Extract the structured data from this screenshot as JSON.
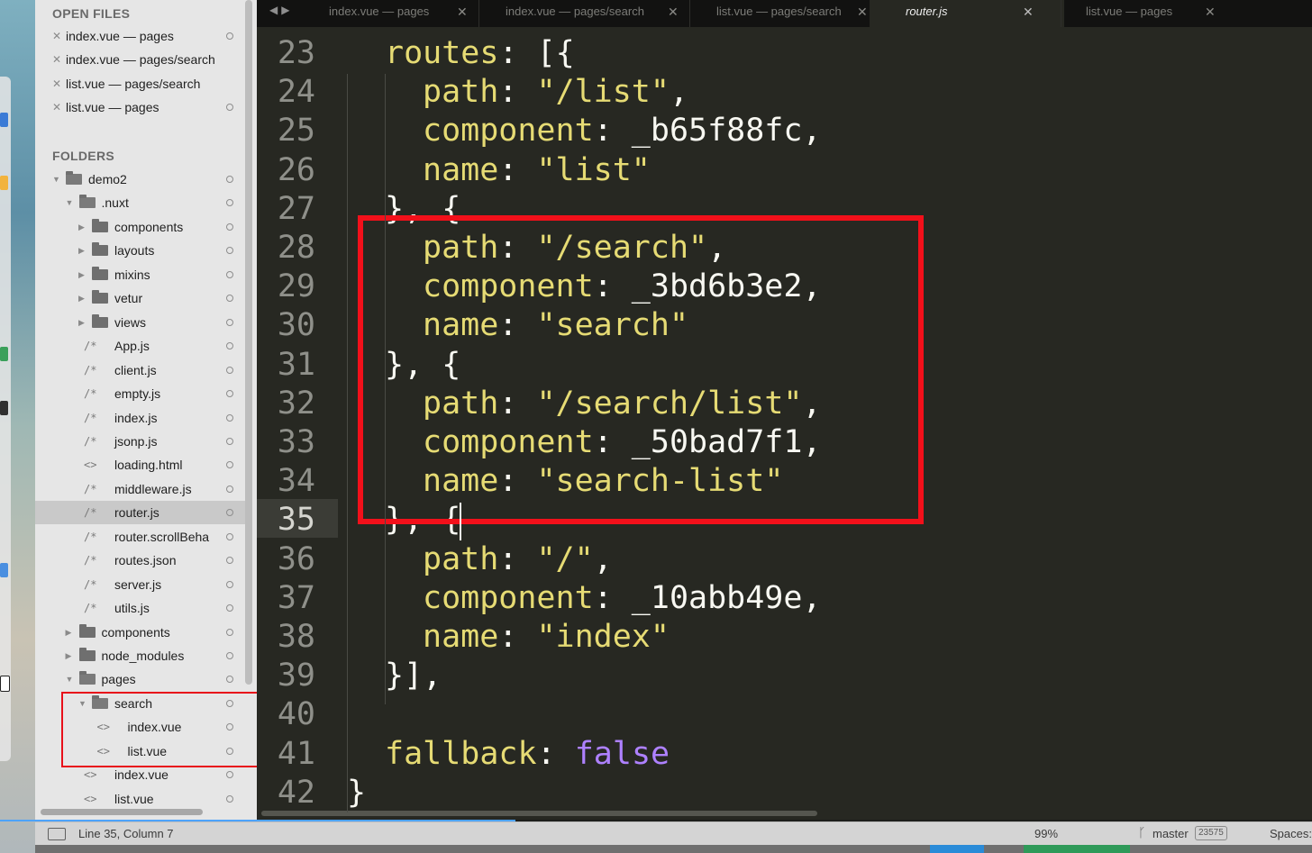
{
  "tabs": [
    {
      "label": "index.vue — pages",
      "active": false
    },
    {
      "label": "index.vue — pages/search",
      "active": false
    },
    {
      "label": "list.vue — pages/search",
      "active": false
    },
    {
      "label": "router.js",
      "active": true
    },
    {
      "label": "list.vue — pages",
      "active": false
    }
  ],
  "sidebar": {
    "open_files_header": "OPEN FILES",
    "open_files": [
      "index.vue — pages",
      "index.vue — pages/search",
      "list.vue — pages/search",
      "list.vue — pages"
    ],
    "folders_header": "FOLDERS",
    "tree": [
      {
        "label": "demo2",
        "type": "folder-open",
        "depth": 0
      },
      {
        "label": ".nuxt",
        "type": "folder-open",
        "depth": 1
      },
      {
        "label": "components",
        "type": "folder",
        "depth": 2
      },
      {
        "label": "layouts",
        "type": "folder",
        "depth": 2
      },
      {
        "label": "mixins",
        "type": "folder",
        "depth": 2
      },
      {
        "label": "vetur",
        "type": "folder",
        "depth": 2
      },
      {
        "label": "views",
        "type": "folder",
        "depth": 2
      },
      {
        "label": "App.js",
        "type": "js",
        "depth": 2
      },
      {
        "label": "client.js",
        "type": "js",
        "depth": 2
      },
      {
        "label": "empty.js",
        "type": "js",
        "depth": 2
      },
      {
        "label": "index.js",
        "type": "js",
        "depth": 2
      },
      {
        "label": "jsonp.js",
        "type": "js",
        "depth": 2
      },
      {
        "label": "loading.html",
        "type": "html",
        "depth": 2
      },
      {
        "label": "middleware.js",
        "type": "js",
        "depth": 2
      },
      {
        "label": "router.js",
        "type": "js",
        "depth": 2,
        "selected": true
      },
      {
        "label": "router.scrollBeha",
        "type": "js",
        "depth": 2
      },
      {
        "label": "routes.json",
        "type": "js",
        "depth": 2
      },
      {
        "label": "server.js",
        "type": "js",
        "depth": 2
      },
      {
        "label": "utils.js",
        "type": "js",
        "depth": 2
      },
      {
        "label": "components",
        "type": "folder",
        "depth": 1
      },
      {
        "label": "node_modules",
        "type": "folder",
        "depth": 1
      },
      {
        "label": "pages",
        "type": "folder-open",
        "depth": 1
      },
      {
        "label": "search",
        "type": "folder-open",
        "depth": 2
      },
      {
        "label": "index.vue",
        "type": "html",
        "depth": 3
      },
      {
        "label": "list.vue",
        "type": "html",
        "depth": 3
      },
      {
        "label": "index.vue",
        "type": "html",
        "depth": 2
      },
      {
        "label": "list.vue",
        "type": "html",
        "depth": 2
      }
    ]
  },
  "editor": {
    "current_line": "35",
    "lines": [
      {
        "n": "23",
        "text": "routes: [{"
      },
      {
        "n": "24",
        "text": "path: \"/list\","
      },
      {
        "n": "25",
        "text": "component: _b65f88fc,"
      },
      {
        "n": "26",
        "text": "name: \"list\""
      },
      {
        "n": "27",
        "text": "}, {"
      },
      {
        "n": "28",
        "text": "path: \"/search\","
      },
      {
        "n": "29",
        "text": "component: _3bd6b3e2,"
      },
      {
        "n": "30",
        "text": "name: \"search\""
      },
      {
        "n": "31",
        "text": "}, {"
      },
      {
        "n": "32",
        "text": "path: \"/search/list\","
      },
      {
        "n": "33",
        "text": "component: _50bad7f1,"
      },
      {
        "n": "34",
        "text": "name: \"search-list\""
      },
      {
        "n": "35",
        "text": "}, {"
      },
      {
        "n": "36",
        "text": "path: \"/\","
      },
      {
        "n": "37",
        "text": "component: _10abb49e,"
      },
      {
        "n": "38",
        "text": "name: \"index\""
      },
      {
        "n": "39",
        "text": "}],"
      },
      {
        "n": "40",
        "text": ""
      },
      {
        "n": "41",
        "text": "fallback: false"
      },
      {
        "n": "42",
        "text": "}"
      }
    ]
  },
  "statusbar": {
    "position": "Line 35, Column 7",
    "zoom": "99%",
    "branch": "master",
    "badge": "23575",
    "indent": "Spaces:"
  },
  "colors": {
    "highlight_box": "#f2101a",
    "editor_bg": "#272822",
    "string": "#e6db74",
    "boolean": "#ae81ff"
  }
}
